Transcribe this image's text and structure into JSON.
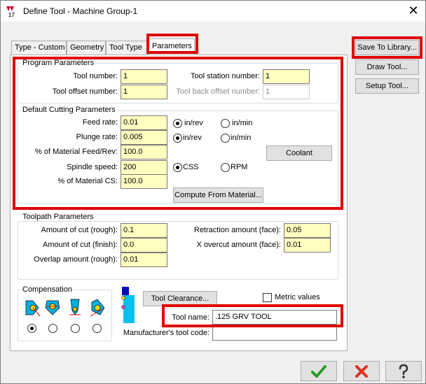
{
  "window": {
    "title": "Define Tool - Machine Group-1",
    "close_glyph": "✕",
    "app_icon_text": "17"
  },
  "tabs": [
    {
      "label": "Type - Custom"
    },
    {
      "label": "Geometry"
    },
    {
      "label": "Tool Type"
    },
    {
      "label": "Parameters"
    }
  ],
  "side_buttons": {
    "save": "Save To Library...",
    "draw": "Draw Tool...",
    "setup": "Setup Tool..."
  },
  "program": {
    "title": "Program Parameters",
    "tool_number_label": "Tool number:",
    "tool_number": "1",
    "tool_offset_label": "Tool offset number:",
    "tool_offset": "1",
    "station_label": "Tool station number:",
    "station": "1",
    "back_offset_label": "Tool back offset number:",
    "back_offset": "1"
  },
  "cutting": {
    "title": "Default Cutting Parameters",
    "feed_label": "Feed rate:",
    "feed": "0.01",
    "plunge_label": "Plunge rate:",
    "plunge": "0.005",
    "matfeed_label": "% of Material Feed/Rev:",
    "matfeed": "100.0",
    "spindle_label": "Spindle speed:",
    "spindle": "200",
    "matcs_label": "% of Material CS:",
    "matcs": "100.0",
    "feed_unit_rev": "in/rev",
    "feed_unit_min": "in/min",
    "plunge_unit_rev": "in/rev",
    "plunge_unit_min": "in/min",
    "css": "CSS",
    "rpm": "RPM",
    "coolant": "Coolant",
    "compute": "Compute From Material..."
  },
  "toolpath": {
    "title": "Toolpath Parameters",
    "rough_label": "Amount of cut (rough):",
    "rough": "0.1",
    "finish_label": "Amount of cut (finish):",
    "finish": "0.0",
    "overlap_label": "Overlap amount (rough):",
    "overlap": "0.01",
    "retraction_label": "Retraction amount (face):",
    "retraction": "0.05",
    "overcut_label": "X overcut amount (face):",
    "overcut": "0.01"
  },
  "compensation": {
    "title": "Compensation",
    "selected_index": 0
  },
  "tool_clearance": "Tool Clearance...",
  "metric_label": "Metric values",
  "tool_name_label": "Tool name:",
  "tool_name": ".125 GRV TOOL",
  "manufacturer_label": "Manufacturer's tool code:",
  "manufacturer": "",
  "colors": {
    "highlight": "#e00000",
    "field_yellow": "#ffffc0",
    "ok_green": "#2a9a2a",
    "cancel_red": "#e03020"
  }
}
